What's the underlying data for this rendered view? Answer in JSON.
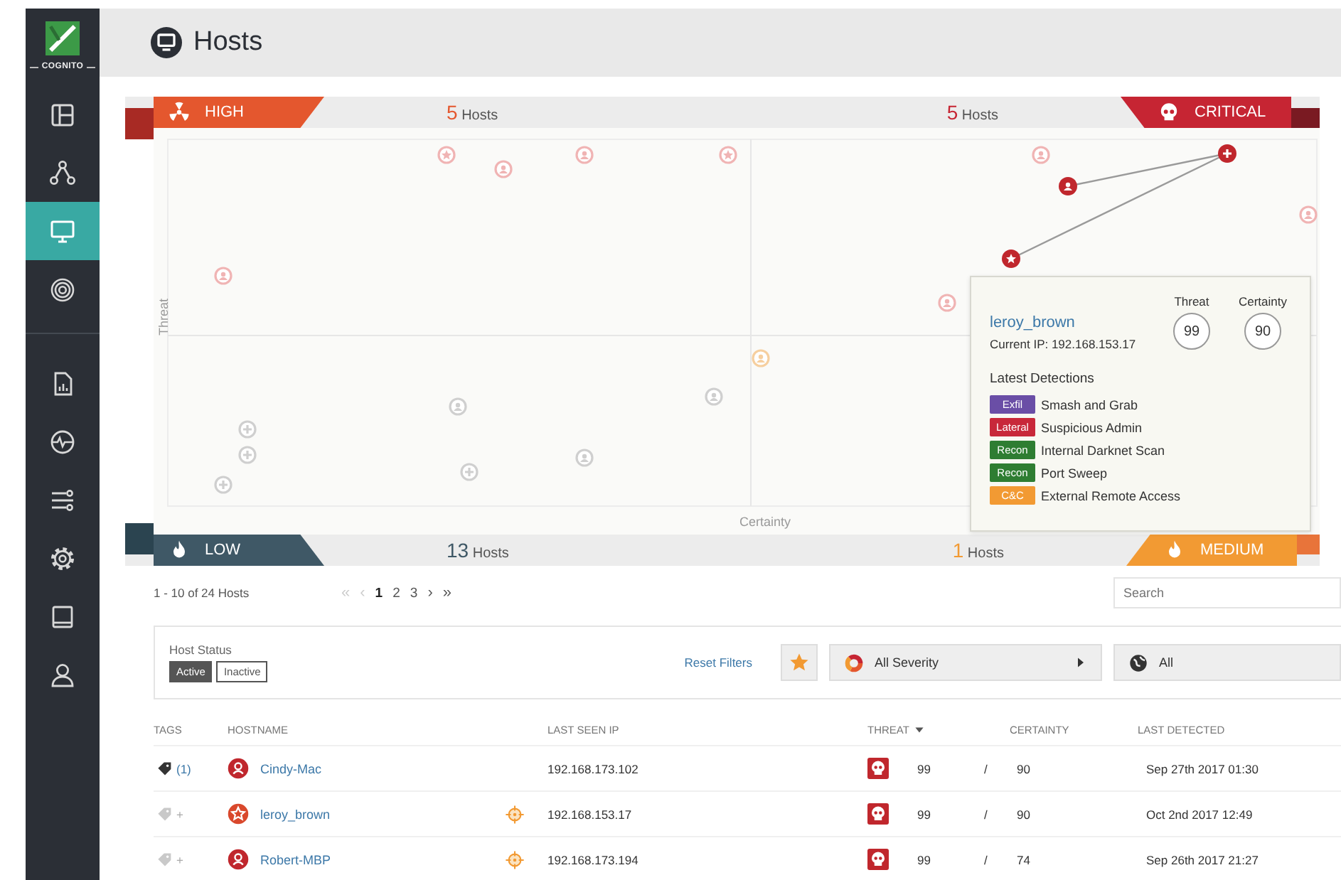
{
  "sidebar": {
    "logo": "COGNITO",
    "items": [
      {
        "kind": "dashboard",
        "selected": false
      },
      {
        "kind": "network",
        "selected": false
      },
      {
        "kind": "hosts",
        "selected": true
      },
      {
        "kind": "radar",
        "selected": false
      },
      {
        "kind": "report",
        "selected": false
      },
      {
        "kind": "health",
        "selected": false
      },
      {
        "kind": "sliders",
        "selected": false
      },
      {
        "kind": "gear",
        "selected": false
      },
      {
        "kind": "book",
        "selected": false
      },
      {
        "kind": "user",
        "selected": false
      }
    ]
  },
  "header": {
    "title": "Hosts"
  },
  "quadrants": {
    "top": [
      {
        "kind": "high",
        "label": "HIGH",
        "count": "5",
        "unit": "Hosts"
      },
      {
        "kind": "critical",
        "label": "CRITICAL",
        "count": "5",
        "unit": "Hosts"
      }
    ],
    "bottom": [
      {
        "kind": "low",
        "label": "LOW",
        "count": "13",
        "unit": "Hosts"
      },
      {
        "kind": "medium",
        "label": "MEDIUM",
        "count": "1",
        "unit": "Hosts"
      }
    ]
  },
  "plot": {
    "y_label": "Threat",
    "x_label": "Certainty"
  },
  "tooltip": {
    "hostname": "leroy_brown",
    "ip": "Current IP: 192.168.153.17",
    "scores": [
      {
        "label": "Threat",
        "value": "99"
      },
      {
        "label": "Certainty",
        "value": "90"
      }
    ],
    "detections_title": "Latest Detections",
    "detections": [
      {
        "tag": "Exfil",
        "color": "#6a4ea6",
        "name": "Smash and Grab"
      },
      {
        "tag": "Lateral",
        "color": "#c8283a",
        "name": "Suspicious Admin"
      },
      {
        "tag": "Recon",
        "color": "#2e7d32",
        "name": "Internal Darknet Scan"
      },
      {
        "tag": "Recon",
        "color": "#2e7d32",
        "name": "Port Sweep"
      },
      {
        "tag": "C&C",
        "color": "#f29a33",
        "name": "External Remote Access"
      }
    ]
  },
  "pagination": {
    "summary": "1 - 10 of 24 Hosts",
    "first": "«",
    "prev": "‹",
    "pages": [
      {
        "label": "1",
        "selected": true
      },
      {
        "label": "2",
        "selected": false
      },
      {
        "label": "3",
        "selected": false
      }
    ],
    "next": "›",
    "last": "»"
  },
  "search": {
    "placeholder": "Search"
  },
  "filters": {
    "label": "Host Status",
    "statuses": [
      {
        "label": "Active",
        "selected": true
      },
      {
        "label": "Inactive",
        "selected": false
      }
    ],
    "reset": "Reset Filters",
    "severity": "All Severity",
    "group": "All"
  },
  "table": {
    "columns": [
      {
        "label": "TAGS",
        "sorted": false
      },
      {
        "label": "HOSTNAME",
        "sorted": false
      },
      {
        "label": "LAST SEEN IP",
        "sorted": false
      },
      {
        "label": "THREAT",
        "sorted": true
      },
      {
        "label": "CERTAINTY",
        "sorted": false
      },
      {
        "label": "LAST DETECTED",
        "sorted": false
      }
    ],
    "rows": [
      {
        "tagged": true,
        "tags": "(1)",
        "kind": "person",
        "hostname": "Cindy-Mac",
        "targeted": false,
        "ip": "192.168.173.102",
        "threat": "99",
        "separator": "/",
        "certainty": "90",
        "last_detected": "Sep 27th 2017 01:30"
      },
      {
        "tagged": false,
        "tags": "+",
        "kind": "star",
        "hostname": "leroy_brown",
        "targeted": true,
        "ip": "192.168.153.17",
        "threat": "99",
        "separator": "/",
        "certainty": "90",
        "last_detected": "Oct 2nd 2017 12:49"
      },
      {
        "tagged": false,
        "tags": "+",
        "kind": "person",
        "hostname": "Robert-MBP",
        "targeted": true,
        "ip": "192.168.173.194",
        "threat": "99",
        "separator": "/",
        "certainty": "74",
        "last_detected": "Sep 26th 2017 21:27"
      }
    ]
  }
}
